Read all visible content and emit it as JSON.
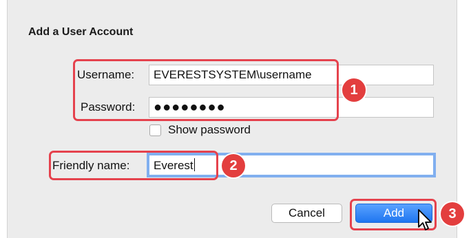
{
  "dialog": {
    "title": "Add a User Account",
    "username": {
      "label": "Username:",
      "value": "EVERESTSYSTEM\\username"
    },
    "password": {
      "label": "Password:",
      "masked_value": "●●●●●●●●"
    },
    "show_password": {
      "label": "Show password",
      "checked": false
    },
    "friendly_name": {
      "label": "Friendly name:",
      "value": "Everest"
    },
    "buttons": {
      "cancel": "Cancel",
      "add": "Add"
    }
  },
  "annotations": {
    "step1": "1",
    "step2": "2",
    "step3": "3",
    "color": "#e33e3e"
  },
  "colors": {
    "focus_ring": "#6ea5f0",
    "primary_button": "#1f76f0"
  }
}
